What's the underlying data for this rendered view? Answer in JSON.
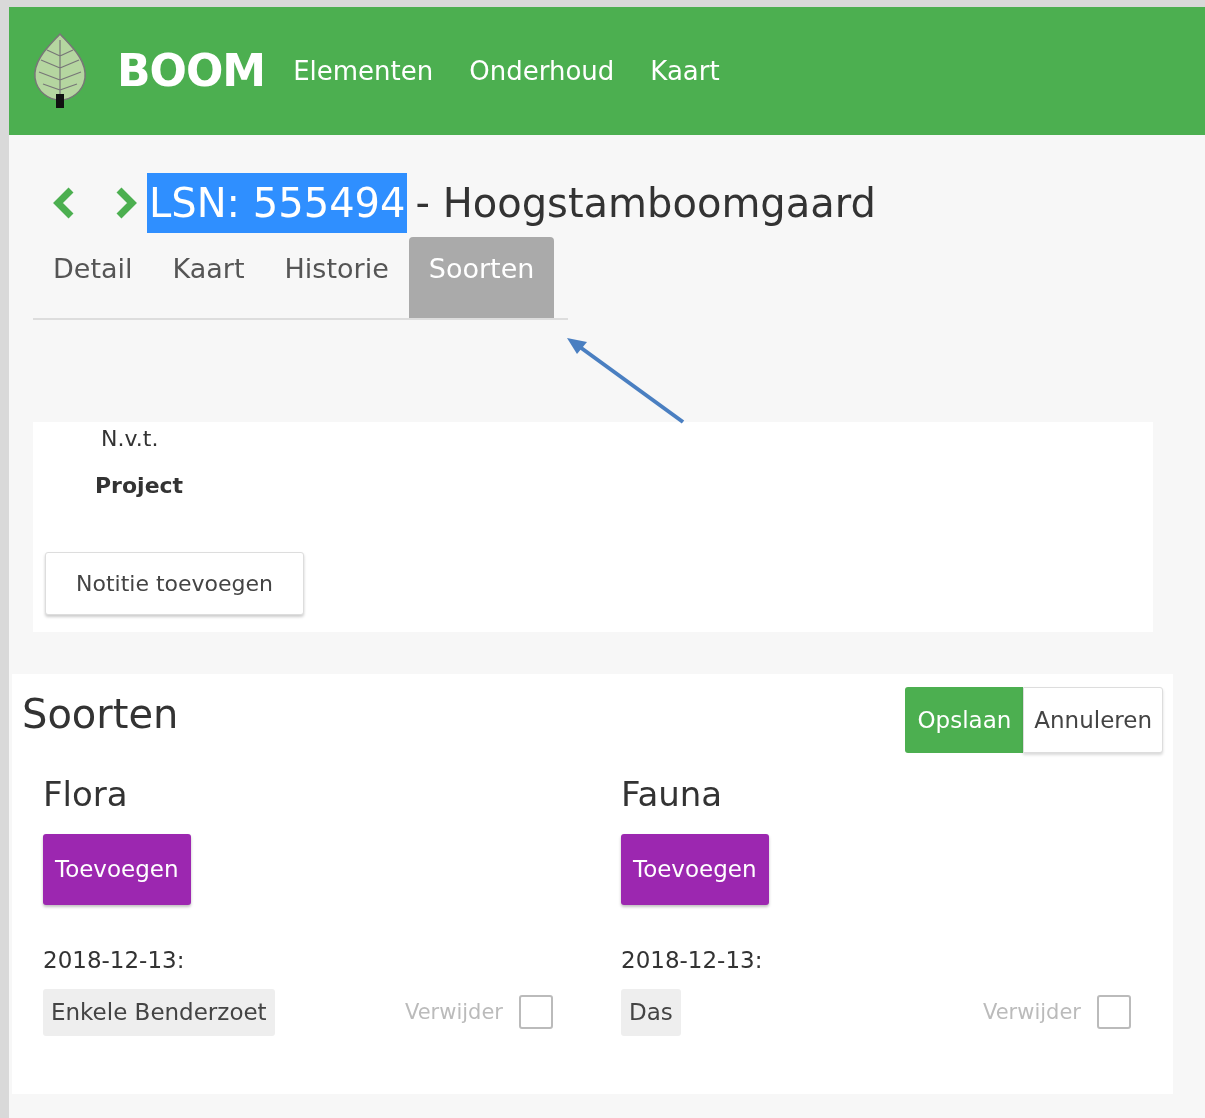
{
  "nav": {
    "brand": "BOOM",
    "links": [
      {
        "label": "Elementen"
      },
      {
        "label": "Onderhoud"
      },
      {
        "label": "Kaart"
      }
    ]
  },
  "header": {
    "id": "LSN: 555494",
    "id_selected": true,
    "title": "- Hoogstamboomgaard"
  },
  "tabs": [
    {
      "label": "Detail",
      "selected": false
    },
    {
      "label": "Kaart",
      "selected": false
    },
    {
      "label": "Historie",
      "selected": false
    },
    {
      "label": "Soorten",
      "selected": true
    }
  ],
  "notes": {
    "value": "N.v.t.",
    "label": "Project",
    "button": "Notitie toevoegen"
  },
  "species": {
    "title": "Soorten",
    "save": "Opslaan",
    "cancel": "Annuleren",
    "groups": [
      {
        "title": "Flora",
        "add": "Toevoegen",
        "entries": [
          {
            "date": "2018-12-13:",
            "items": [
              {
                "name": "Enkele Benderzoet",
                "remove_label": "Verwijder",
                "checked": false
              }
            ]
          }
        ]
      },
      {
        "title": "Fauna",
        "add": "Toevoegen",
        "entries": [
          {
            "date": "2018-12-13:",
            "items": [
              {
                "name": "Das",
                "remove_label": "Verwijder",
                "checked": false
              }
            ]
          }
        ]
      }
    ]
  }
}
